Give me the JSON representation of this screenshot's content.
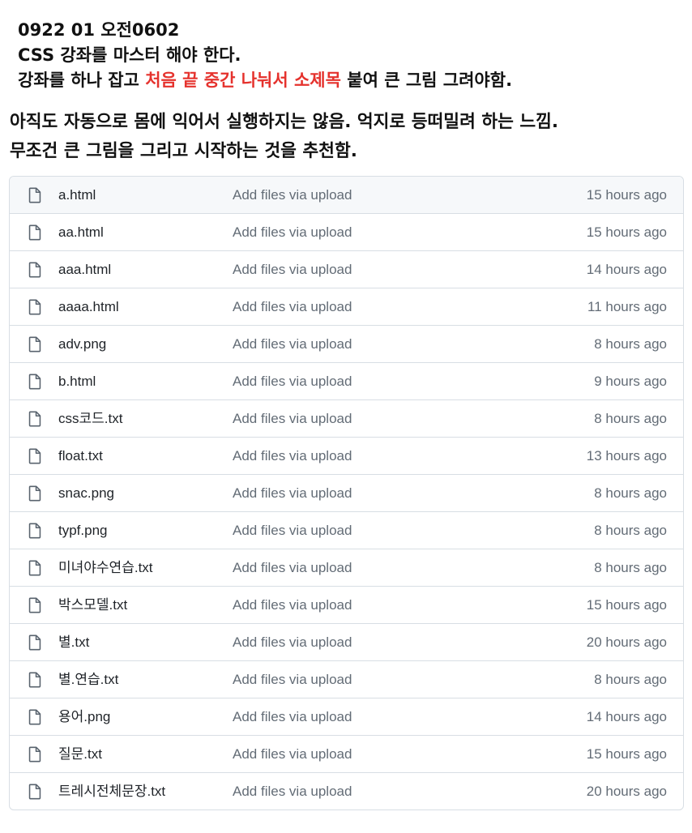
{
  "notes": {
    "line1": "0922 01 오전0602",
    "line2": "CSS 강좌를 마스터 해야 한다.",
    "line3_prefix": "강좌를 하나 잡고 ",
    "line3_highlight": "처음 끝 중간 나눠서 소제목",
    "line3_suffix": " 붙여 큰 그림 그려야함.",
    "highlight_color": "#e5322d"
  },
  "notes2": {
    "line1": "아직도 자동으로 몸에 익어서 실행하지는 않음. 억지로 등떠밀려 하는 느낌.",
    "line2": "무조건 큰 그림을 그리고 시작하는 것을 추천함."
  },
  "files": [
    {
      "name": "a.html",
      "message": "Add files via upload",
      "age": "15 hours ago",
      "icon": "file-icon"
    },
    {
      "name": "aa.html",
      "message": "Add files via upload",
      "age": "15 hours ago",
      "icon": "file-icon"
    },
    {
      "name": "aaa.html",
      "message": "Add files via upload",
      "age": "14 hours ago",
      "icon": "file-icon"
    },
    {
      "name": "aaaa.html",
      "message": "Add files via upload",
      "age": "11 hours ago",
      "icon": "file-icon"
    },
    {
      "name": "adv.png",
      "message": "Add files via upload",
      "age": "8 hours ago",
      "icon": "file-icon"
    },
    {
      "name": "b.html",
      "message": "Add files via upload",
      "age": "9 hours ago",
      "icon": "file-icon"
    },
    {
      "name": "css코드.txt",
      "message": "Add files via upload",
      "age": "8 hours ago",
      "icon": "file-icon"
    },
    {
      "name": "float.txt",
      "message": "Add files via upload",
      "age": "13 hours ago",
      "icon": "file-icon"
    },
    {
      "name": "snac.png",
      "message": "Add files via upload",
      "age": "8 hours ago",
      "icon": "file-icon"
    },
    {
      "name": "typf.png",
      "message": "Add files via upload",
      "age": "8 hours ago",
      "icon": "file-icon"
    },
    {
      "name": "미녀야수연습.txt",
      "message": "Add files via upload",
      "age": "8 hours ago",
      "icon": "file-icon"
    },
    {
      "name": "박스모델.txt",
      "message": "Add files via upload",
      "age": "15 hours ago",
      "icon": "file-icon"
    },
    {
      "name": "별.txt",
      "message": "Add files via upload",
      "age": "20 hours ago",
      "icon": "file-icon"
    },
    {
      "name": "별.연습.txt",
      "message": "Add files via upload",
      "age": "8 hours ago",
      "icon": "file-icon"
    },
    {
      "name": "용어.png",
      "message": "Add files via upload",
      "age": "14 hours ago",
      "icon": "file-icon"
    },
    {
      "name": "질문.txt",
      "message": "Add files via upload",
      "age": "15 hours ago",
      "icon": "file-icon"
    },
    {
      "name": "트레시전체문장.txt",
      "message": "Add files via upload",
      "age": "20 hours ago",
      "icon": "file-icon"
    }
  ]
}
